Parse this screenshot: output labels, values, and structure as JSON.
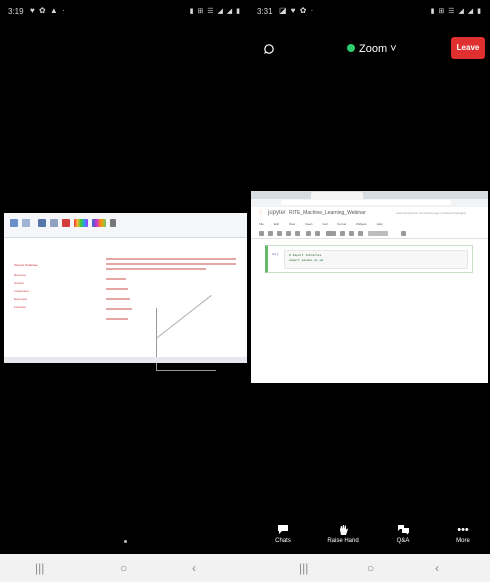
{
  "left_phone": {
    "status": {
      "time": "3:19",
      "left_icons": "♥ ✿ ▲ ·",
      "right_icons": "▮ ⊞ ☰ ◢ ◢ ▮"
    },
    "shared_screen": {
      "list_items": [
        "Sample Database",
        "Revenue",
        "Growth",
        "Investment",
        "Expenses",
        "Forecast"
      ],
      "para_lines": 3
    },
    "navbar": {
      "recent": "|||",
      "home": "○",
      "back": "‹"
    }
  },
  "right_phone": {
    "status": {
      "time": "3:31",
      "left_icons": "◪ ♥ ✿ ·",
      "right_icons": "▮ ⊞ ☰ ◢ ◢ ▮"
    },
    "header": {
      "app_title": "Zoom ˅",
      "leave_label": "Leave",
      "camera_icon": "camera-switch-icon",
      "shield_color": "#2ecc71",
      "leave_color": "#e02f2f"
    },
    "shared_screen": {
      "jupyter_brand": "jupyter",
      "notebook_title": "RITE_Machine_Learning_Webinar",
      "notebook_meta": "Last Checkpoint: 11 minutes ago  (unsaved changes)",
      "menu": [
        "File",
        "Edit",
        "View",
        "Insert",
        "Cell",
        "Kernel",
        "Widgets",
        "Help"
      ],
      "cell_prompt": "In [ ]:",
      "cell_code": [
        "# Import libraries",
        "import pandas as pd"
      ]
    },
    "bottom_bar": {
      "items": [
        {
          "label": "Chats",
          "icon": "chat-icon"
        },
        {
          "label": "Raise Hand",
          "icon": "raise-hand-icon"
        },
        {
          "label": "Q&A",
          "icon": "qa-icon"
        },
        {
          "label": "More",
          "icon": "more-icon"
        }
      ]
    },
    "navbar": {
      "recent": "|||",
      "home": "○",
      "back": "‹"
    }
  }
}
